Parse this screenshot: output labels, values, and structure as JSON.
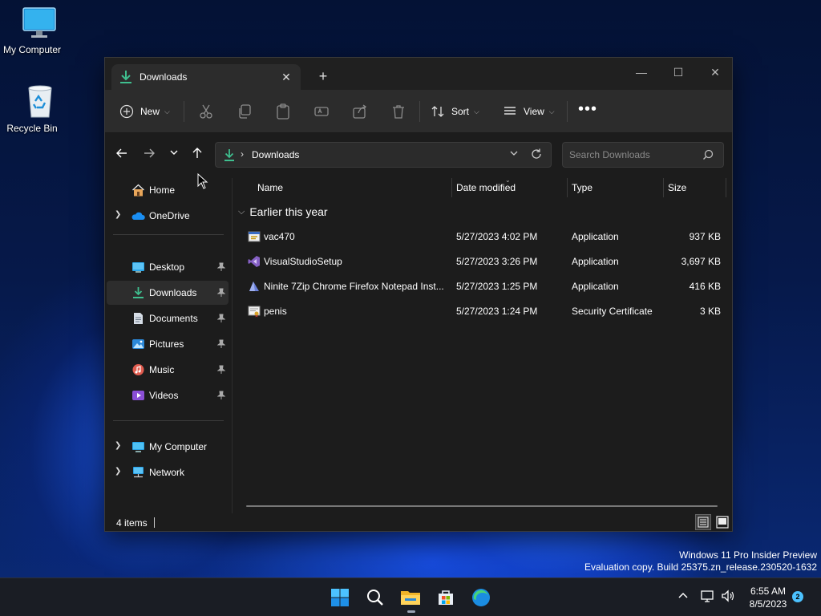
{
  "desktop": {
    "icons": [
      {
        "label": "My Computer",
        "icon": "monitor-icon"
      },
      {
        "label": "Recycle Bin",
        "icon": "recycle-bin-icon"
      }
    ]
  },
  "window": {
    "tab": {
      "title": "Downloads",
      "icon": "download-arrow-icon"
    },
    "new_tab": "+",
    "controls": {
      "minimize": "—",
      "maximize": "☐",
      "close": "✕"
    }
  },
  "toolbar": {
    "new_label": "New",
    "sort_label": "Sort",
    "view_label": "View",
    "more_label": "•••",
    "disabled_actions": [
      "cut-icon",
      "copy-icon",
      "paste-icon",
      "rename-icon",
      "share-icon",
      "delete-icon"
    ]
  },
  "navigation": {
    "back": "←",
    "forward": "→",
    "recent": "⌄",
    "up": "↑",
    "address": {
      "path": "Downloads",
      "separator": "›"
    },
    "search": {
      "placeholder": "Search Downloads"
    }
  },
  "sidebar": {
    "items": [
      {
        "label": "Home",
        "icon": "home-icon",
        "expandable": false,
        "pinned": false
      },
      {
        "label": "OneDrive",
        "icon": "onedrive-cloud-icon",
        "expandable": true,
        "pinned": false
      },
      {
        "label": "Desktop",
        "icon": "desktop-folder-icon",
        "expandable": false,
        "pinned": true
      },
      {
        "label": "Downloads",
        "icon": "downloads-folder-icon",
        "expandable": false,
        "pinned": true,
        "active": true
      },
      {
        "label": "Documents",
        "icon": "documents-folder-icon",
        "expandable": false,
        "pinned": true
      },
      {
        "label": "Pictures",
        "icon": "pictures-folder-icon",
        "expandable": false,
        "pinned": true
      },
      {
        "label": "Music",
        "icon": "music-folder-icon",
        "expandable": false,
        "pinned": true
      },
      {
        "label": "Videos",
        "icon": "videos-folder-icon",
        "expandable": false,
        "pinned": true
      },
      {
        "label": "My Computer",
        "icon": "computer-icon",
        "expandable": true,
        "pinned": false
      },
      {
        "label": "Network",
        "icon": "network-icon",
        "expandable": true,
        "pinned": false
      }
    ]
  },
  "file_list": {
    "columns": [
      "Name",
      "Date modified",
      "Type",
      "Size"
    ],
    "group": "Earlier this year",
    "rows": [
      {
        "name": "vac470",
        "date": "5/27/2023 4:02 PM",
        "type": "Application",
        "size": "937 KB",
        "icon": "installer-icon"
      },
      {
        "name": "VisualStudioSetup",
        "date": "5/27/2023 3:26 PM",
        "type": "Application",
        "size": "3,697 KB",
        "icon": "visual-studio-icon"
      },
      {
        "name": "Ninite 7Zip Chrome Firefox Notepad Inst...",
        "date": "5/27/2023 1:25 PM",
        "type": "Application",
        "size": "416 KB",
        "icon": "ninite-icon"
      },
      {
        "name": "penis",
        "date": "5/27/2023 1:24 PM",
        "type": "Security Certificate",
        "size": "3 KB",
        "icon": "certificate-icon"
      }
    ]
  },
  "status": {
    "item_count": "4 items"
  },
  "watermark": {
    "line1": "Windows 11 Pro Insider Preview",
    "line2": "Evaluation copy. Build 25375.zn_release.230520-1632"
  },
  "taskbar": {
    "apps": [
      "windows-start-icon",
      "search-icon",
      "file-explorer-icon",
      "microsoft-store-icon",
      "edge-icon"
    ],
    "clock": {
      "time": "6:55 AM",
      "date": "8/5/2023"
    },
    "notifications": "2"
  },
  "colors": {
    "accent": "#4cc2ff",
    "window_bg": "#1c1c1c",
    "toolbar_bg": "#2c2c2c",
    "download_green": "#3fbf8f"
  }
}
